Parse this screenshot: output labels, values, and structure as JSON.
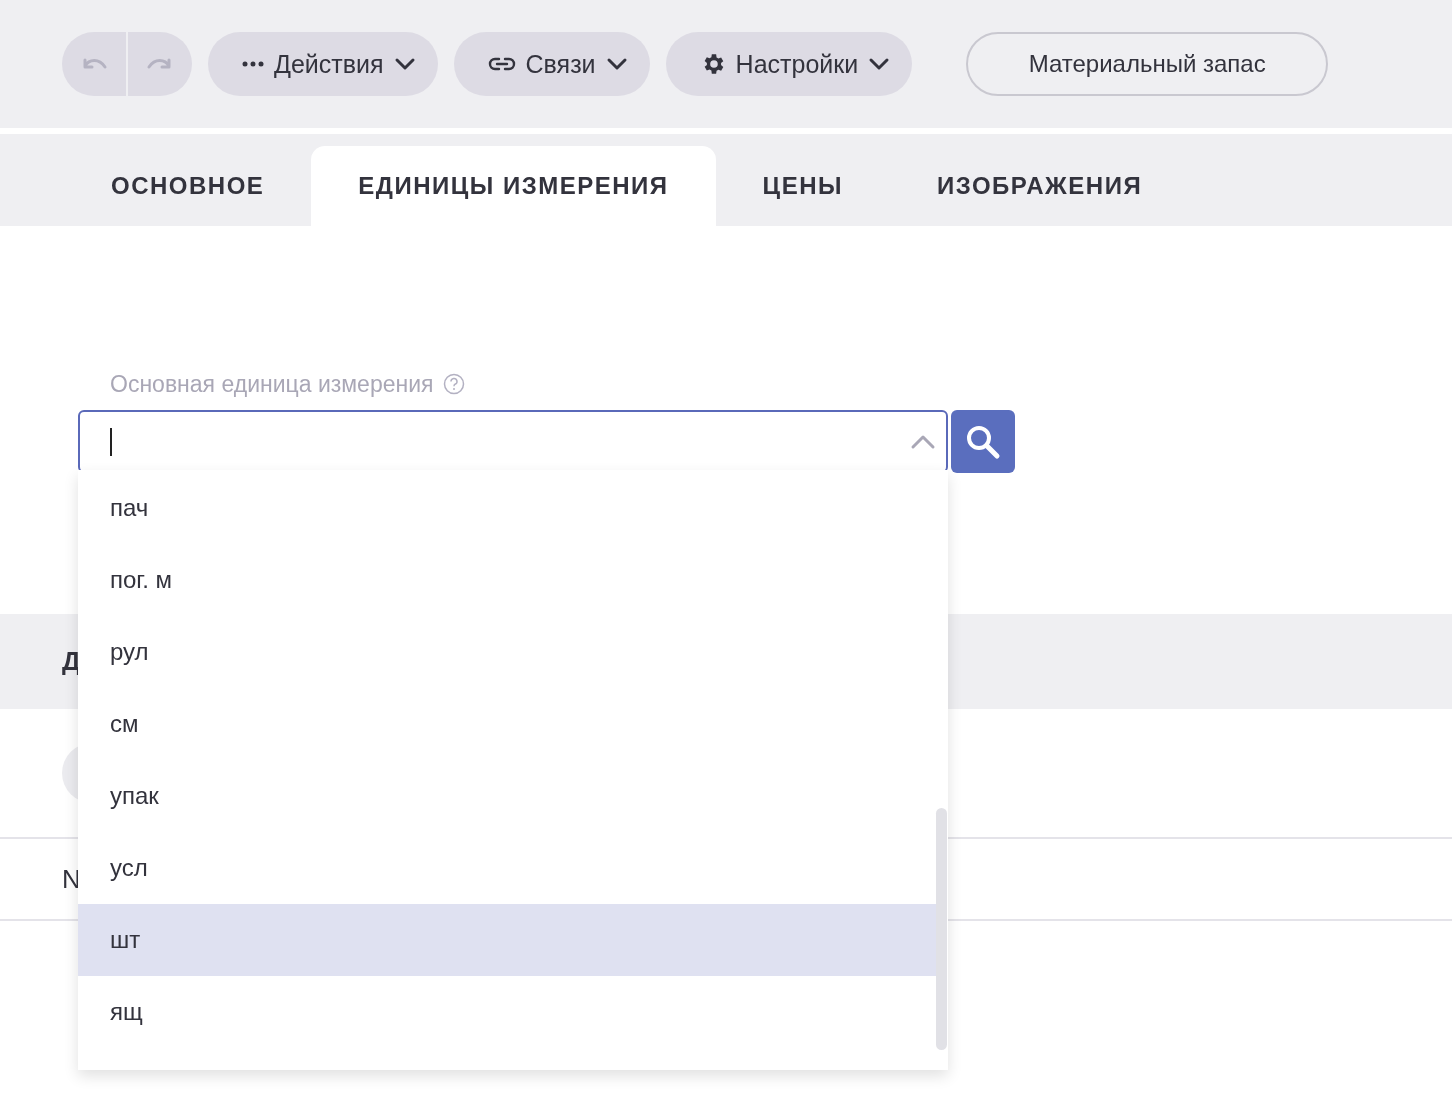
{
  "toolbar": {
    "undo_disabled": true,
    "redo_disabled": true,
    "menus": [
      {
        "kind": "dots",
        "label": "Действия"
      },
      {
        "kind": "link",
        "label": "Связи"
      },
      {
        "kind": "gear",
        "label": "Настройки"
      }
    ],
    "stock_button": "Материальный запас"
  },
  "tabs": [
    {
      "label": "ОСНОВНОЕ",
      "selected": false
    },
    {
      "label": "ЕДИНИЦЫ ИЗМЕРЕНИЯ",
      "selected": true
    },
    {
      "label": "ЦЕНЫ",
      "selected": false
    },
    {
      "label": "ИЗОБРАЖЕНИЯ",
      "selected": false
    }
  ],
  "unit_field": {
    "label": "Основная единица измерения",
    "expanded": true
  },
  "background": {
    "section_heading": "Д",
    "row_text": "N"
  },
  "dropdown_options": [
    {
      "label": "пач",
      "selected": false
    },
    {
      "label": "пог. м",
      "selected": false
    },
    {
      "label": "рул",
      "selected": false
    },
    {
      "label": "см",
      "selected": false
    },
    {
      "label": "упак",
      "selected": false
    },
    {
      "label": "усл",
      "selected": false
    },
    {
      "label": "шт",
      "selected": true
    },
    {
      "label": "ящ",
      "selected": false
    }
  ]
}
